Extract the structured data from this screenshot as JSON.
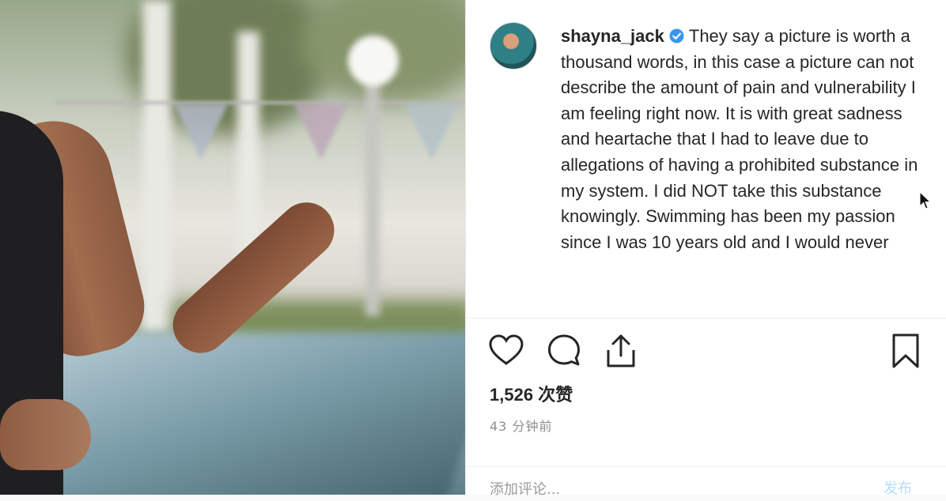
{
  "post": {
    "username": "shayna_jack",
    "verified": true,
    "caption": "They say a picture is worth a thousand words, in this case a picture can not describe the amount of pain and vulnerability I am feeling right now. It is with great sadness and heartache that I had to leave due to allegations of having a prohibited substance in my system. I did NOT take this substance knowingly. Swimming has been my passion since I was 10 years old and I would never",
    "likes_count": "1,526",
    "likes_unit": "次赞",
    "time_ago": "43 分钟前",
    "comment_placeholder": "添加评论...",
    "post_button": "发布"
  },
  "icons": {
    "like": "heart-icon",
    "comment": "comment-bubble-icon",
    "share": "share-icon",
    "save": "bookmark-icon",
    "verified": "verified-badge-icon"
  },
  "colors": {
    "verified_blue": "#3897f0",
    "text": "#262626",
    "muted": "#8e8e8e"
  }
}
